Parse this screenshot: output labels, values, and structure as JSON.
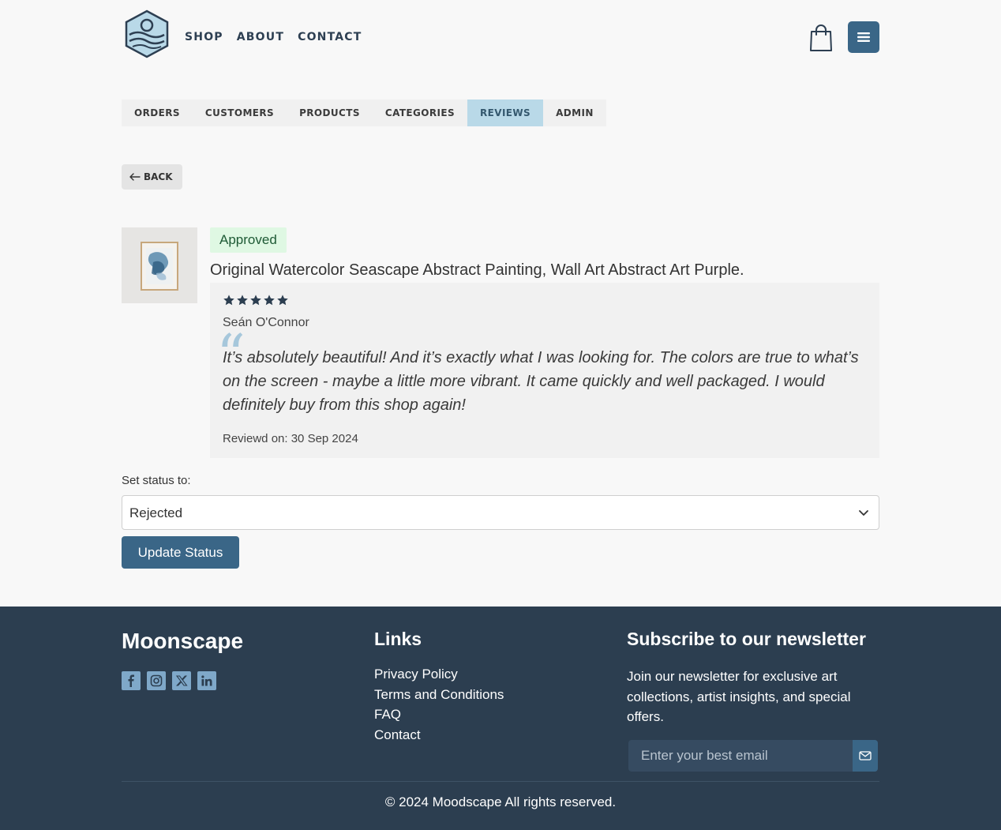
{
  "header": {
    "nav": [
      "SHOP",
      "ABOUT",
      "CONTACT"
    ]
  },
  "admin_tabs": {
    "items": [
      "ORDERS",
      "CUSTOMERS",
      "PRODUCTS",
      "CATEGORIES",
      "REVIEWS",
      "ADMIN"
    ],
    "active": "REVIEWS"
  },
  "back_label": "BACK",
  "review": {
    "status_badge": "Approved",
    "product_title": "Original Watercolor Seascape Abstract Painting, Wall Art Abstract Art Purple.",
    "rating": 5,
    "reviewer": "Seán O'Connor",
    "text": "It’s absolutely beautiful! And it’s exactly what I was looking for. The colors are true to what’s on the screen - maybe a little more vibrant. It came quickly and well packaged. I would definitely buy from this shop again!",
    "date": "Reviewd on: 30 Sep 2024"
  },
  "status_form": {
    "label": "Set status to:",
    "selected": "Rejected",
    "button": "Update Status"
  },
  "footer": {
    "brand": "Moonscape",
    "links_title": "Links",
    "links": [
      "Privacy Policy",
      "Terms and Conditions",
      "FAQ",
      "Contact"
    ],
    "newsletter_title": "Subscribe to our newsletter",
    "newsletter_text": "Join our newsletter for exclusive art collections, artist insights, and special offers.",
    "email_placeholder": "Enter your best email",
    "copyright": "© 2024 Moodscape All rights reserved."
  },
  "colors": {
    "primary": "#3a6687",
    "footer_bg": "#2c3e50",
    "active_tab": "#b9d9e8",
    "approved_bg": "#dff8e3"
  }
}
